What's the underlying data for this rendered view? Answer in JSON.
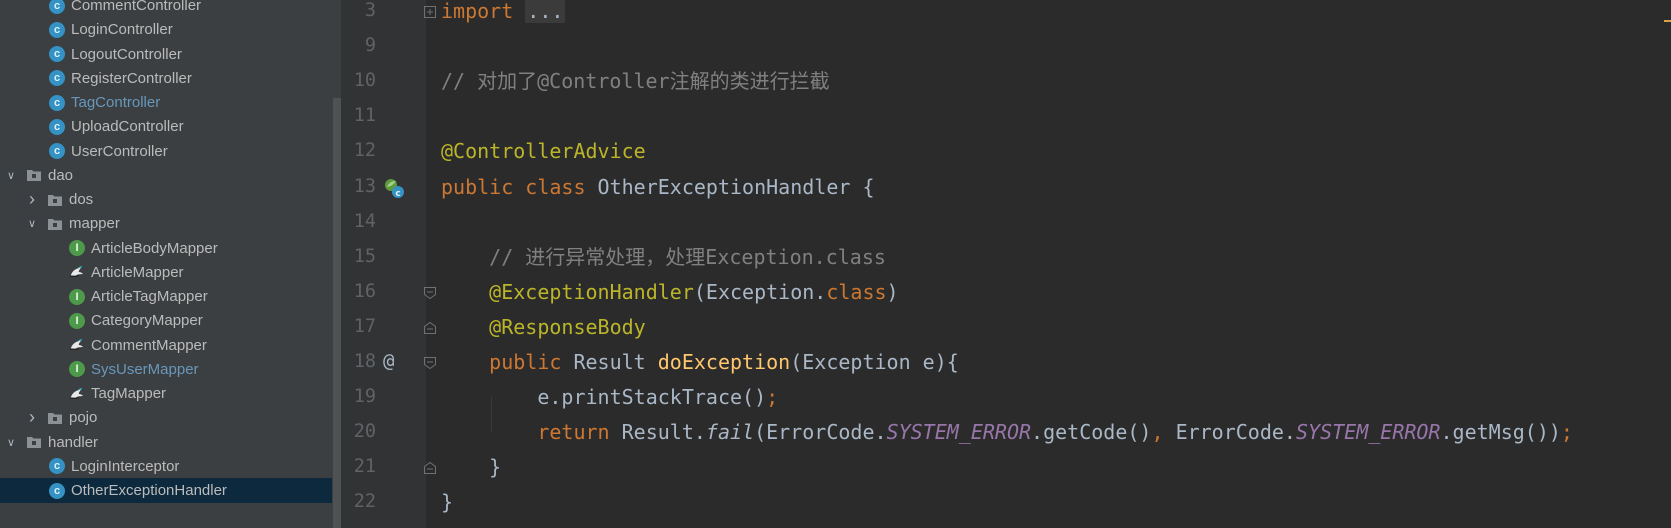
{
  "project_tree": [
    {
      "label": "CommentController",
      "icon": "class-icon",
      "level": 2,
      "type": "class"
    },
    {
      "label": "LoginController",
      "icon": "class-icon",
      "level": 2,
      "type": "class"
    },
    {
      "label": "LogoutController",
      "icon": "class-icon",
      "level": 2,
      "type": "class"
    },
    {
      "label": "RegisterController",
      "icon": "class-icon",
      "level": 2,
      "type": "class"
    },
    {
      "label": "TagController",
      "icon": "class-icon",
      "level": 2,
      "type": "class",
      "modified": true
    },
    {
      "label": "UploadController",
      "icon": "class-icon",
      "level": 2,
      "type": "class"
    },
    {
      "label": "UserController",
      "icon": "class-icon",
      "level": 2,
      "type": "class"
    },
    {
      "label": "dao",
      "icon": "folder-icon",
      "level": 0,
      "type": "folder",
      "expanded": true
    },
    {
      "label": "dos",
      "icon": "folder-icon",
      "level": 1,
      "type": "folder",
      "expanded": false
    },
    {
      "label": "mapper",
      "icon": "folder-icon",
      "level": 1,
      "type": "folder",
      "expanded": true
    },
    {
      "label": "ArticleBodyMapper",
      "icon": "interface-icon",
      "level": 3,
      "type": "interface"
    },
    {
      "label": "ArticleMapper",
      "icon": "mybatis-icon",
      "level": 3,
      "type": "mybatis"
    },
    {
      "label": "ArticleTagMapper",
      "icon": "interface-icon",
      "level": 3,
      "type": "interface"
    },
    {
      "label": "CategoryMapper",
      "icon": "interface-icon",
      "level": 3,
      "type": "interface"
    },
    {
      "label": "CommentMapper",
      "icon": "mybatis-icon",
      "level": 3,
      "type": "mybatis"
    },
    {
      "label": "SysUserMapper",
      "icon": "interface-icon",
      "level": 3,
      "type": "interface",
      "modified": true
    },
    {
      "label": "TagMapper",
      "icon": "mybatis-icon",
      "level": 3,
      "type": "mybatis"
    },
    {
      "label": "pojo",
      "icon": "folder-icon",
      "level": 1,
      "type": "folder",
      "expanded": false
    },
    {
      "label": "handler",
      "icon": "folder-icon",
      "level": 0,
      "type": "folder",
      "expanded": true
    },
    {
      "label": "LoginInterceptor",
      "icon": "class-icon",
      "level": 2,
      "type": "class"
    },
    {
      "label": "OtherExceptionHandler",
      "icon": "class-icon",
      "level": 2,
      "type": "class",
      "selected": true
    }
  ],
  "gutter": {
    "line_numbers": [
      "3",
      "9",
      "10",
      "11",
      "12",
      "13",
      "14",
      "15",
      "16",
      "17",
      "18",
      "19",
      "20",
      "21",
      "22"
    ],
    "override_marker": "@"
  },
  "code": [
    [
      {
        "t": "import ",
        "c": "kw"
      },
      {
        "t": "...",
        "c": "fold-box"
      }
    ],
    [],
    [
      {
        "t": "// 对加了@Controller注解的类进行拦截",
        "c": "cmt"
      }
    ],
    [],
    [
      {
        "t": "@ControllerAdvice",
        "c": "ann"
      }
    ],
    [
      {
        "t": "public class ",
        "c": "kw"
      },
      {
        "t": "OtherExceptionHandler {",
        "c": ""
      }
    ],
    [],
    [
      {
        "t": "    // 进行异常处理，处理Exception.class",
        "c": "cmt"
      }
    ],
    [
      {
        "t": "    ",
        "c": ""
      },
      {
        "t": "@ExceptionHandler",
        "c": "ann"
      },
      {
        "t": "(Exception.",
        "c": ""
      },
      {
        "t": "class",
        "c": "kw"
      },
      {
        "t": ")",
        "c": ""
      }
    ],
    [
      {
        "t": "    ",
        "c": ""
      },
      {
        "t": "@ResponseBody",
        "c": "ann"
      }
    ],
    [
      {
        "t": "    ",
        "c": ""
      },
      {
        "t": "public ",
        "c": "kw"
      },
      {
        "t": "Result ",
        "c": ""
      },
      {
        "t": "doException",
        "c": "fn"
      },
      {
        "t": "(Exception e){",
        "c": ""
      }
    ],
    [
      {
        "t": "        e.printStackTrace()",
        "c": ""
      },
      {
        "t": ";",
        "c": "kw"
      }
    ],
    [
      {
        "t": "        ",
        "c": ""
      },
      {
        "t": "return ",
        "c": "kw"
      },
      {
        "t": "Result.",
        "c": ""
      },
      {
        "t": "fail",
        "c": "ital"
      },
      {
        "t": "(ErrorCode.",
        "c": ""
      },
      {
        "t": "SYSTEM_ERROR",
        "c": "const"
      },
      {
        "t": ".getCode()",
        "c": ""
      },
      {
        "t": ", ",
        "c": "kw"
      },
      {
        "t": "ErrorCode.",
        "c": ""
      },
      {
        "t": "SYSTEM_ERROR",
        "c": "const"
      },
      {
        "t": ".getMsg())",
        "c": ""
      },
      {
        "t": ";",
        "c": "kw"
      }
    ],
    [
      {
        "t": "    }",
        "c": ""
      }
    ],
    [
      {
        "t": "}",
        "c": ""
      }
    ]
  ],
  "colors": {
    "editor_bg": "#2b2b2b",
    "gutter_bg": "#313335",
    "tree_bg": "#3c3f41",
    "selection": "#0d293e",
    "keyword": "#cc7832",
    "annotation": "#bbb529",
    "comment": "#808080",
    "method": "#ffc66d",
    "constant": "#9876aa"
  }
}
